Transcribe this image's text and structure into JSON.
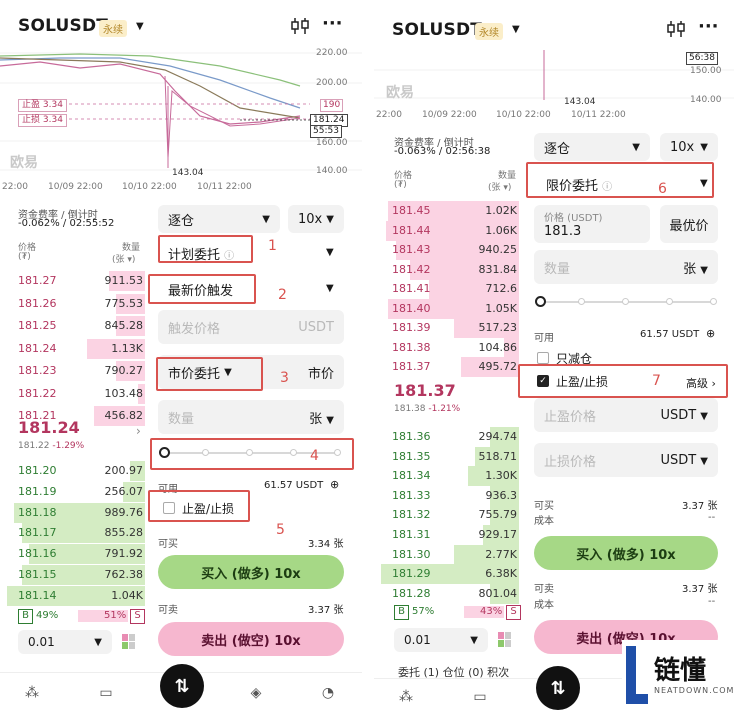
{
  "left": {
    "symbol": "SOLUSDT",
    "contract_badge": "永续",
    "chart": {
      "y_ticks": [
        "220.00",
        "200.00",
        "190",
        "181.24",
        "55:53",
        "160.00",
        "140.00"
      ],
      "x_ticks": [
        "22:00",
        "10/09 22:00",
        "10/10 22:00",
        "10/11 22:00"
      ],
      "low_label": "143.04",
      "tp_label": "止盈",
      "tp_value": "3.34",
      "sl_label": "止损",
      "sl_value": "3.34",
      "watermark": "欧易"
    },
    "funding_label": "资金费率 / 倒计时",
    "funding_value": "-0.062% / 02:55:52",
    "price_header": "价格",
    "price_unit": "(₮)",
    "qty_header": "数量",
    "qty_unit": "(张 ▾)",
    "asks": [
      {
        "price": "181.27",
        "qty": "911.53",
        "depth": 0.25
      },
      {
        "price": "181.26",
        "qty": "775.53",
        "depth": 0.2
      },
      {
        "price": "181.25",
        "qty": "845.28",
        "depth": 0.2
      },
      {
        "price": "181.24",
        "qty": "1.13K",
        "depth": 0.4
      },
      {
        "price": "181.23",
        "qty": "790.27",
        "depth": 0.2
      },
      {
        "price": "181.22",
        "qty": "103.48",
        "depth": 0.05
      },
      {
        "price": "181.21",
        "qty": "456.82",
        "depth": 0.35
      }
    ],
    "last_price": "181.24",
    "mark_price": "181.22",
    "change": "-1.29%",
    "bids": [
      {
        "price": "181.20",
        "qty": "200.97",
        "depth": 0.1
      },
      {
        "price": "181.19",
        "qty": "256.07",
        "depth": 0.15
      },
      {
        "price": "181.18",
        "qty": "989.76",
        "depth": 0.9
      },
      {
        "price": "181.17",
        "qty": "855.28",
        "depth": 0.85
      },
      {
        "price": "181.16",
        "qty": "791.92",
        "depth": 0.8
      },
      {
        "price": "181.15",
        "qty": "762.38",
        "depth": 0.85
      },
      {
        "price": "181.14",
        "qty": "1.04K",
        "depth": 0.95
      }
    ],
    "buy_ratio_label": "B",
    "buy_ratio": "49%",
    "sell_ratio": "51%",
    "sell_ratio_label": "S",
    "tick_size": "0.01",
    "margin_mode": "逐仓",
    "leverage": "10x",
    "order_type": "计划委托",
    "trigger_type": "最新价触发",
    "trigger_price_placeholder": "触发价格",
    "trigger_price_unit": "USDT",
    "exec_type": "市价委托",
    "exec_price": "市价",
    "qty_placeholder": "数量",
    "qty_unit_select": "张",
    "available_label": "可用",
    "available_value": "61.57 USDT",
    "tpsl_label": "止盈/止损",
    "can_buy_label": "可买",
    "can_buy_value": "3.34 张",
    "buy_button": "买入 (做多) 10x",
    "can_sell_label": "可卖",
    "can_sell_value": "3.37 张",
    "sell_button": "卖出 (做空) 10x",
    "annotations": [
      "1",
      "2",
      "3",
      "4",
      "5"
    ]
  },
  "right": {
    "symbol": "SOLUSDT",
    "contract_badge": "永续",
    "chart": {
      "y_ticks": [
        "56:38",
        "150.00",
        "140.00"
      ],
      "x_ticks": [
        "22:00",
        "10/09 22:00",
        "10/10 22:00",
        "10/11 22:00"
      ],
      "low_label": "143.04",
      "watermark": "欧易"
    },
    "funding_label": "资金费率 / 倒计时",
    "funding_value": "-0.063% / 02:56:38",
    "price_header": "价格",
    "price_unit": "(₮)",
    "qty_header": "数量",
    "qty_unit": "(张 ▾)",
    "asks": [
      {
        "price": "181.45",
        "qty": "1.02K",
        "depth": 0.9
      },
      {
        "price": "181.44",
        "qty": "1.06K",
        "depth": 0.92
      },
      {
        "price": "181.43",
        "qty": "940.25",
        "depth": 0.85
      },
      {
        "price": "181.42",
        "qty": "831.84",
        "depth": 0.75
      },
      {
        "price": "181.41",
        "qty": "712.6",
        "depth": 0.62
      },
      {
        "price": "181.40",
        "qty": "1.05K",
        "depth": 0.9
      },
      {
        "price": "181.39",
        "qty": "517.23",
        "depth": 0.45
      },
      {
        "price": "181.38",
        "qty": "104.86",
        "depth": 0.1
      },
      {
        "price": "181.37",
        "qty": "495.72",
        "depth": 0.4
      }
    ],
    "last_price": "181.37",
    "mark_price": "181.38",
    "change": "-1.21%",
    "bids": [
      {
        "price": "181.36",
        "qty": "294.74",
        "depth": 0.2
      },
      {
        "price": "181.35",
        "qty": "518.71",
        "depth": 0.3
      },
      {
        "price": "181.34",
        "qty": "1.30K",
        "depth": 0.35
      },
      {
        "price": "181.33",
        "qty": "936.3",
        "depth": 0.2
      },
      {
        "price": "181.32",
        "qty": "755.79",
        "depth": 0.2
      },
      {
        "price": "181.31",
        "qty": "929.17",
        "depth": 0.25
      },
      {
        "price": "181.30",
        "qty": "2.77K",
        "depth": 0.45
      },
      {
        "price": "181.29",
        "qty": "6.38K",
        "depth": 0.95
      },
      {
        "price": "181.28",
        "qty": "801.04",
        "depth": 0.2
      }
    ],
    "buy_ratio_label": "B",
    "buy_ratio": "57%",
    "sell_ratio": "43%",
    "sell_ratio_label": "S",
    "tick_size": "0.01",
    "margin_mode": "逐仓",
    "leverage": "10x",
    "order_type": "限价委托",
    "price_field_label": "价格 (USDT)",
    "price_field_value": "181.3",
    "best_price_button": "最优价",
    "qty_placeholder": "数量",
    "qty_unit_select": "张",
    "available_label": "可用",
    "available_value": "61.57 USDT",
    "reduce_only_label": "只减仓",
    "tpsl_label": "止盈/止损",
    "advanced_label": "高级",
    "tp_price_placeholder": "止盈价格",
    "tp_unit": "USDT",
    "sl_price_placeholder": "止损价格",
    "sl_unit": "USDT",
    "can_buy_label": "可买",
    "can_buy_value": "3.37 张",
    "cost_label": "成本",
    "cost_value": "--",
    "buy_button": "买入 (做多) 10x",
    "can_sell_label": "可卖",
    "can_sell_value": "3.37 张",
    "cost2_label": "成本",
    "cost2_value": "--",
    "sell_button": "卖出 (做空) 10x",
    "bottom_tabs_partial": "委托 (1)   仓位 (0)   积次",
    "annotations": [
      "6",
      "7"
    ]
  },
  "brand": {
    "name": "链懂",
    "domain": "NEATDOWN.COM"
  }
}
